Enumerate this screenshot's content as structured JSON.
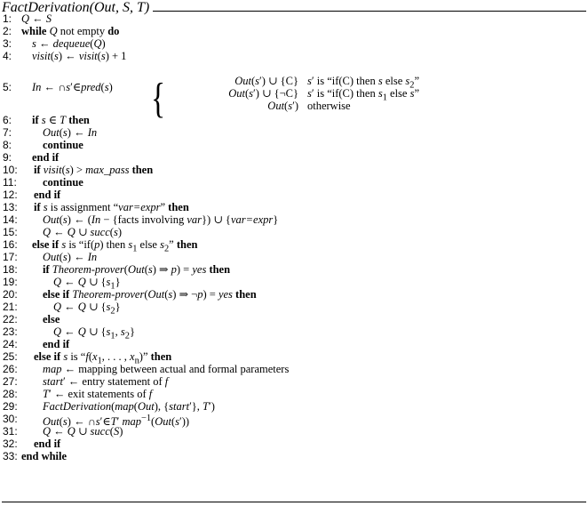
{
  "header": {
    "title": "FactDerivation(Out, S, T)"
  },
  "lines": [
    {
      "n": "1:",
      "text": "Q ← S"
    },
    {
      "n": "2:",
      "text": "while Q not empty do"
    },
    {
      "n": "3:",
      "text": "s ← dequeue(Q)"
    },
    {
      "n": "4:",
      "text": "visit(s) ← visit(s) + 1"
    },
    {
      "n": "5:",
      "text": "In ← ∩s′∈pred(s)"
    },
    {
      "n": "6:",
      "text": "if s ∈ T then"
    },
    {
      "n": "7:",
      "text": "Out(s) ← In"
    },
    {
      "n": "8:",
      "text": "continue"
    },
    {
      "n": "9:",
      "text": "end if"
    },
    {
      "n": "10:",
      "text": "if visit(s) > max_pass then"
    },
    {
      "n": "11:",
      "text": "continue"
    },
    {
      "n": "12:",
      "text": "end if"
    },
    {
      "n": "13:",
      "text": "if s is assignment “var=expr” then"
    },
    {
      "n": "14:",
      "text": "Out(s) ← (In − {facts involving var}) ∪ {var=expr}"
    },
    {
      "n": "15:",
      "text": "Q ← Q ∪ succ(s)"
    },
    {
      "n": "16:",
      "text": "else if s is “if(p) then s1 else s2” then"
    },
    {
      "n": "17:",
      "text": "Out(s) ← In"
    },
    {
      "n": "18:",
      "text": "if Theorem-prover(Out(s) ⇒ p) = yes then"
    },
    {
      "n": "19:",
      "text": "Q ← Q ∪ {s1}"
    },
    {
      "n": "20:",
      "text": "else if Theorem-prover(Out(s) ⇒ ¬p) = yes then"
    },
    {
      "n": "21:",
      "text": "Q ← Q ∪ {s2}"
    },
    {
      "n": "22:",
      "text": "else"
    },
    {
      "n": "23:",
      "text": "Q ← Q ∪ {s1, s2}"
    },
    {
      "n": "24:",
      "text": "end if"
    },
    {
      "n": "25:",
      "text": "else if s is “f(x1, . . . , xn)” then"
    },
    {
      "n": "26:",
      "text": "map ← mapping between actual and formal parameters"
    },
    {
      "n": "27:",
      "text": "start′ ← entry statement of f"
    },
    {
      "n": "28:",
      "text": "T′ ← exit statements of f"
    },
    {
      "n": "29:",
      "text": "FactDerivation(map(Out), {start′}, T′)"
    },
    {
      "n": "30:",
      "text": "Out(s) ← ∩s′∈T′ map−1(Out(s′))"
    },
    {
      "n": "31:",
      "text": "Q ← Q ∪ succ(S)"
    },
    {
      "n": "32:",
      "text": "end if"
    },
    {
      "n": "33:",
      "text": "end while"
    }
  ],
  "cases": [
    {
      "expr": "Out(s′) ∪ {C}",
      "cond": "s′ is “if(C) then s else s2”"
    },
    {
      "expr": "Out(s′) ∪ {¬C}",
      "cond": "s′ is “if(C) then s1 else s”"
    },
    {
      "expr": "Out(s′)",
      "cond": "otherwise"
    }
  ],
  "tokens": {
    "while": "while",
    "do": "do",
    "not_empty": "not empty",
    "if": "if",
    "then": "then",
    "else_if": "else if",
    "else": "else",
    "end_if": "end if",
    "end_while": "end while",
    "continue": "continue",
    "Q": "Q",
    "S": "S",
    "s": "s",
    "T": "T",
    "p": "p",
    "f": "f",
    "In": "In",
    "yes": "yes"
  }
}
